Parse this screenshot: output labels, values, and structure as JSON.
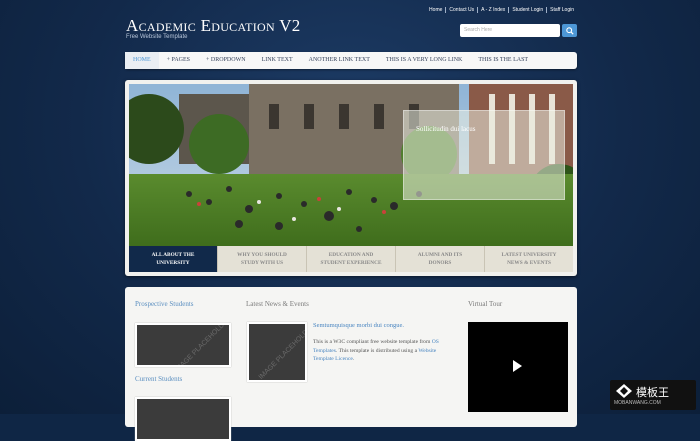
{
  "header": {
    "logo": "Academic Education V2",
    "tagline": "Free Website Template",
    "top_links": [
      "Home",
      "Contact Us",
      "A - Z Index",
      "Student Login",
      "Staff Login"
    ],
    "search_placeholder": "Search Here"
  },
  "nav": {
    "items": [
      "Home",
      "+ Pages",
      "+ Dropdown",
      "Link Text",
      "Another Link Text",
      "This Is A Very Long Link",
      "This Is The Last"
    ],
    "active_index": 0
  },
  "slider": {
    "caption_title": "Sollicitudin dui lacus",
    "tabs": [
      {
        "line1": "All About The",
        "line2": "University"
      },
      {
        "line1": "Why You Should",
        "line2": "Study With Us"
      },
      {
        "line1": "Education And",
        "line2": "Student Experience"
      },
      {
        "line1": "Alumni And Its",
        "line2": "Donors"
      },
      {
        "line1": "Latest University",
        "line2": "News & Events"
      }
    ],
    "active_tab": 0
  },
  "content": {
    "prospective_heading": "Prospective Students",
    "current_heading": "Current Students",
    "news_heading": "Latest News & Events",
    "news_title": "Semtumquisque morbi dui congue.",
    "news_body_1": "This is a W3C compliant free website template from ",
    "news_link_1": "OS Templates",
    "news_body_2": ". This template is distributed using a ",
    "news_link_2": "Website Template Licence",
    "news_body_3": ".",
    "tour_heading": "Virtual Tour",
    "thumb_text": "IMAGE PLACEHOLDER"
  },
  "watermark": {
    "title": "模板王",
    "url": "MOBANWANG.COM"
  },
  "colors": {
    "background": "#12294a",
    "accent": "#4d97d6",
    "active_tab": "#11294a"
  }
}
